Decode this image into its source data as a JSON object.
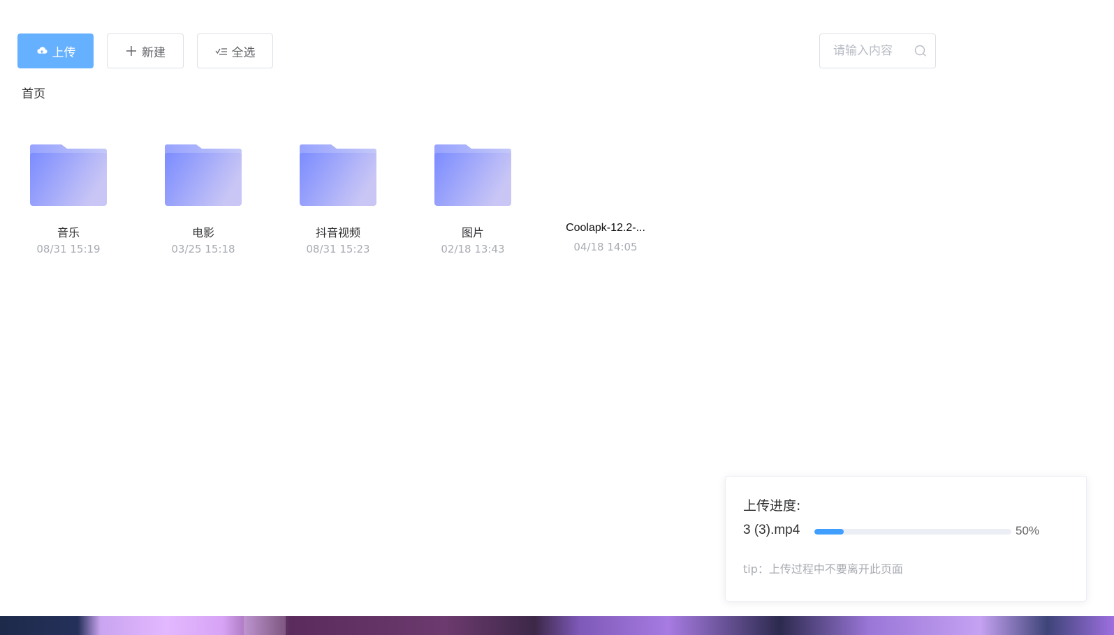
{
  "toolbar": {
    "upload_label": "上传",
    "new_label": "新建",
    "select_all_label": "全选"
  },
  "search": {
    "placeholder": "请输入内容"
  },
  "breadcrumb": {
    "home": "首页"
  },
  "items": [
    {
      "name": "音乐",
      "date": "08/31 15:19",
      "kind": "folder"
    },
    {
      "name": "电影",
      "date": "03/25 15:18",
      "kind": "folder"
    },
    {
      "name": "抖音视频",
      "date": "08/31 15:23",
      "kind": "folder"
    },
    {
      "name": "图片",
      "date": "02/18 13:43",
      "kind": "folder"
    },
    {
      "name": "Coolapk-12.2-...",
      "date": "04/18 14:05",
      "kind": "file"
    }
  ],
  "upload_panel": {
    "title": "上传进度:",
    "file_name": "3 (3).mp4",
    "progress": 0.15,
    "percent_text": "50%",
    "tip": "tip：上传过程中不要离开此页面"
  },
  "colors": {
    "primary": "#66b1ff",
    "progress": "#409eff",
    "folder_start": "#7b8cff",
    "folder_end": "#c9c6f5"
  },
  "icons": {
    "upload": "cloud-upload-icon",
    "new": "plus-icon",
    "select_all": "checklist-icon",
    "search": "search-icon",
    "folder": "folder-icon"
  }
}
